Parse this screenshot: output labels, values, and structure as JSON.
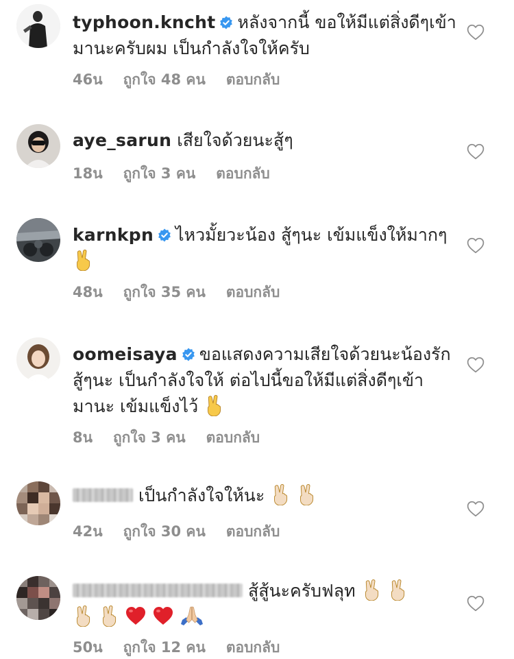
{
  "comments": [
    {
      "username": "typhoon.kncht",
      "verified": true,
      "text": "หลังจากนี้ ขอให้มีแต่สิ่งดีๆเข้ามานะครับผม เป็นกำลังใจให้ครับ",
      "time": "46น",
      "likes": "ถูกใจ 48 คน",
      "reply": "ตอบกลับ"
    },
    {
      "username": "aye_sarun",
      "verified": false,
      "text": "เสียใจด้วยนะสู้ๆ",
      "time": "18น",
      "likes": "ถูกใจ 3 คน",
      "reply": "ตอบกลับ"
    },
    {
      "username": "karnkpn",
      "verified": true,
      "text": "ไหวมั้ยวะน้อง สู้ๆนะ เข้มแข็งให้มากๆ",
      "emojis": [
        "victory-hand-icon"
      ],
      "time": "48น",
      "likes": "ถูกใจ 35 คน",
      "reply": "ตอบกลับ"
    },
    {
      "username": "oomeisaya",
      "verified": true,
      "text": "ขอแสดงความเสียใจด้วยนะน้องรัก สู้ๆนะ เป็นกำลังใจให้ ต่อไปนี้ขอให้มีแต่สิ่งดีๆเข้ามานะ เข้มแข็งไว้",
      "emojis": [
        "victory-hand-icon"
      ],
      "time": "8น",
      "likes": "ถูกใจ 3 คน",
      "reply": "ตอบกลับ"
    },
    {
      "username": "",
      "verified": false,
      "text": "เป็นกำลังใจให้นะ",
      "emojis": [
        "victory-hand-light-icon",
        "victory-hand-light-icon"
      ],
      "time": "42น",
      "likes": "ถูกใจ 30 คน",
      "reply": "ตอบกลับ"
    },
    {
      "username": "",
      "verified": false,
      "text": "สู้สู้นะครับฟลุท",
      "emojis": [
        "victory-hand-light-icon",
        "victory-hand-light-icon",
        "victory-hand-light-icon",
        "victory-hand-light-icon",
        "red-heart-icon",
        "red-heart-icon",
        "folded-hands-icon"
      ],
      "time": "50น",
      "likes": "ถูกใจ 12 คน",
      "reply": "ตอบกลับ"
    }
  ],
  "colors": {
    "text": "#262626",
    "meta": "#8e8e8e",
    "verified": "#3897f0",
    "heart_outline": "#8e8e8e",
    "red_heart": "#e0202a",
    "victory_yellow": "#f7c94a",
    "victory_light": "#f3dcc2"
  }
}
